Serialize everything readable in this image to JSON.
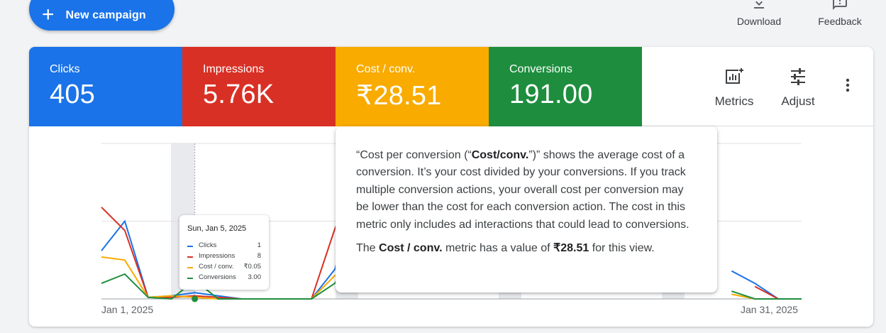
{
  "header": {
    "new_campaign_label": "New campaign",
    "download_label": "Download",
    "feedback_label": "Feedback"
  },
  "scorecards": [
    {
      "name": "Clicks",
      "value": "405",
      "color": "#1a73e8"
    },
    {
      "name": "Impressions",
      "value": "5.76K",
      "color": "#d93025"
    },
    {
      "name": "Cost / conv.",
      "value": "₹28.51",
      "color": "#f9ab00"
    },
    {
      "name": "Conversions",
      "value": "191.00",
      "color": "#1e8e3e"
    }
  ],
  "tools": {
    "metrics_label": "Metrics",
    "adjust_label": "Adjust",
    "more_icon": "more-vert-icon"
  },
  "hover_card": {
    "date": "Sun, Jan 5, 2025",
    "rows": [
      {
        "name": "Clicks",
        "value": "1",
        "color": "#1a73e8"
      },
      {
        "name": "Impressions",
        "value": "8",
        "color": "#d93025"
      },
      {
        "name": "Cost / conv.",
        "value": "₹0.05",
        "color": "#f9ab00"
      },
      {
        "name": "Conversions",
        "value": "3.00",
        "color": "#1e8e3e"
      }
    ]
  },
  "tooltip": {
    "p1_a": "“Cost per conversion (“",
    "p1_b": "Cost/conv.",
    "p1_c": "”)” shows the average cost of a conversion. It’s your cost divided by your conversions. If you track multiple conversion actions, your overall cost per conversion may be lower than the cost for each conversion action. The cost in this metric only includes ad interactions that could lead to conversions.",
    "p2_a": "The ",
    "p2_b": "Cost / conv.",
    "p2_c": " metric has a value of ",
    "p2_d": "₹28.51",
    "p2_e": " for this view."
  },
  "chart_data": {
    "type": "line",
    "x_start_label": "Jan 1, 2025",
    "x_end_label": "Jan 31, 2025",
    "x": [
      1,
      2,
      3,
      4,
      5,
      6,
      7,
      8,
      9,
      10,
      11,
      12,
      13,
      14,
      15,
      16,
      17,
      18,
      19,
      20,
      21,
      22,
      23,
      24,
      25,
      26,
      27,
      28,
      29,
      30,
      31
    ],
    "grid": true,
    "highlighted_point": 5,
    "series": [
      {
        "name": "Clicks",
        "color": "#1a73e8",
        "values": [
          0.31,
          0.5,
          0.01,
          0.02,
          0.04,
          0.02,
          0.0,
          0.0,
          0.0,
          0.0,
          0.19,
          0.7,
          null,
          null,
          null,
          null,
          null,
          null,
          null,
          null,
          null,
          null,
          null,
          null,
          null,
          null,
          null,
          0.18,
          0.1,
          0.0,
          0.0
        ]
      },
      {
        "name": "Impressions",
        "color": "#d93025",
        "values": [
          0.59,
          0.44,
          0.01,
          0.01,
          0.02,
          0.01,
          0.0,
          0.0,
          0.0,
          0.0,
          0.45,
          0.8,
          null,
          null,
          null,
          null,
          null,
          null,
          null,
          null,
          null,
          null,
          null,
          null,
          null,
          null,
          null,
          null,
          0.08,
          0.0,
          0.0
        ]
      },
      {
        "name": "Cost / conv.",
        "color": "#f9ab00",
        "values": [
          0.27,
          0.25,
          0.01,
          0.02,
          0.01,
          0.0,
          0.0,
          0.0,
          0.0,
          0.0,
          0.15,
          0.17,
          null,
          null,
          null,
          null,
          null,
          null,
          null,
          null,
          null,
          null,
          null,
          null,
          null,
          null,
          null,
          0.03,
          0.0,
          0.0,
          0.0
        ]
      },
      {
        "name": "Conversions",
        "color": "#1e8e3e",
        "values": [
          0.1,
          0.16,
          0.01,
          0.0,
          0.12,
          0.0,
          0.0,
          0.0,
          0.0,
          0.0,
          0.1,
          0.35,
          null,
          null,
          null,
          null,
          null,
          null,
          null,
          null,
          null,
          null,
          null,
          null,
          null,
          null,
          null,
          0.05,
          0.0,
          0.0,
          0.0
        ]
      }
    ]
  }
}
